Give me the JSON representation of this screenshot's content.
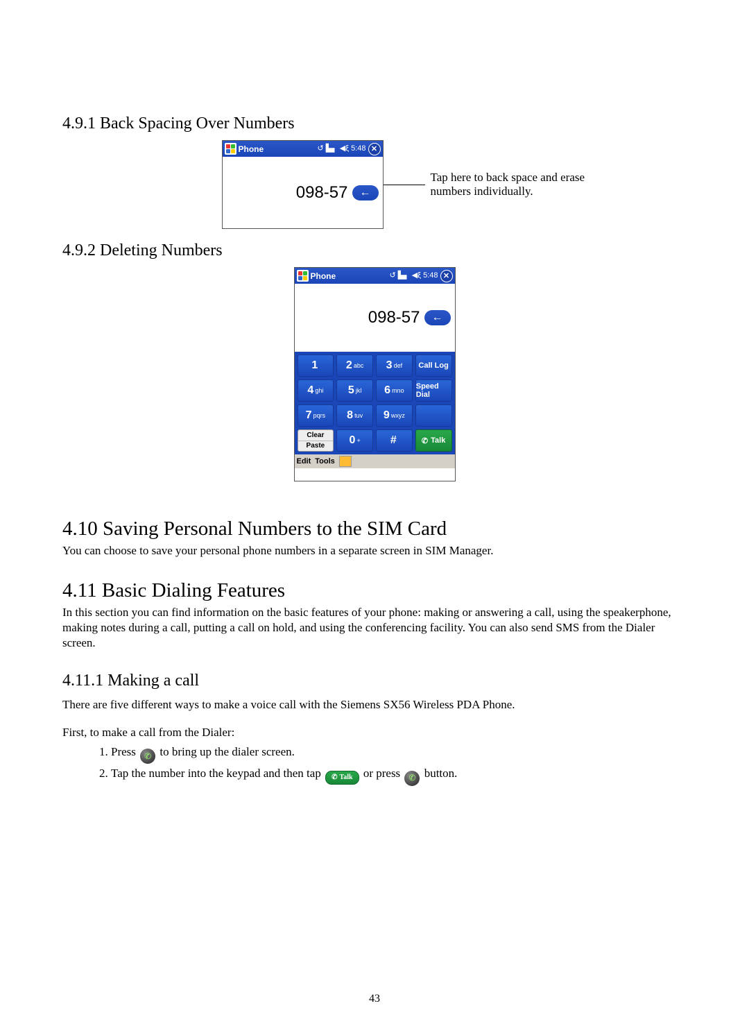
{
  "sections": {
    "s491": "4.9.1 Back Spacing Over Numbers",
    "s492": "4.9.2 Deleting Numbers",
    "s410": "4.10   Saving Personal Numbers to the SIM Card",
    "s411": "4.11   Basic Dialing Features",
    "s4111": "4.11.1  Making a call"
  },
  "para": {
    "p410": "You can choose to save your personal phone numbers in a separate screen in SIM Manager.",
    "p411": "In this section you can find information on the basic features of your phone: making or answering a call, using the speakerphone, making notes during a call, putting a call on hold, and using the conferencing facility. You can also send SMS from the Dialer screen.",
    "p4111a": "There are five different ways to make a voice call with the Siemens SX56 Wireless PDA Phone.",
    "p4111b": "First, to make a call from the Dialer:",
    "step1_a": "Press ",
    "step1_b": " to bring up the dialer screen.",
    "step2_a": "Tap the number into the keypad and then tap ",
    "step2_b": " or press ",
    "step2_c": " button."
  },
  "callout": "Tap here to back space and erase numbers individually.",
  "phone": {
    "title": "Phone",
    "time": "5:48",
    "number": "098-57",
    "keys": [
      {
        "n": "1",
        "t": ""
      },
      {
        "n": "2",
        "t": "abc"
      },
      {
        "n": "3",
        "t": "def"
      },
      {
        "n": "4",
        "t": "ghi"
      },
      {
        "n": "5",
        "t": "jkl"
      },
      {
        "n": "6",
        "t": "mno"
      },
      {
        "n": "7",
        "t": "pqrs"
      },
      {
        "n": "8",
        "t": "tuv"
      },
      {
        "n": "9",
        "t": "wxyz"
      },
      {
        "n": "0",
        "t": "+"
      }
    ],
    "side": {
      "calllog": "Call Log",
      "speeddial": "Speed Dial",
      "talk": "Talk"
    },
    "split": {
      "clear": "Clear",
      "paste": "Paste"
    },
    "hash": "#",
    "menu": {
      "edit": "Edit",
      "tools": "Tools"
    }
  },
  "pagenum": "43"
}
